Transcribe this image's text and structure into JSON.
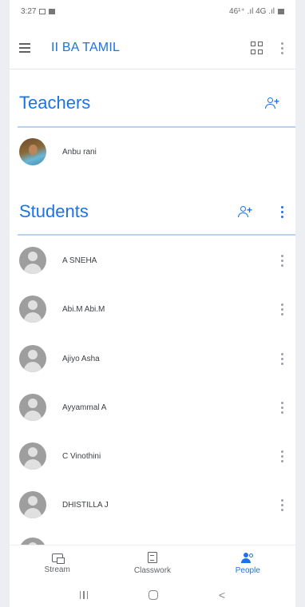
{
  "status_bar": {
    "time": "3:27",
    "right_text": "46¹⁺ .ıl 4G .ıl"
  },
  "app_bar": {
    "title": "II BA TAMIL",
    "icons": [
      "menu-icon",
      "grid-icon",
      "more-vert-icon"
    ]
  },
  "teachers": {
    "heading": "Teachers",
    "items": [
      {
        "name": "Anbu rani",
        "avatar": "photo"
      }
    ]
  },
  "students": {
    "heading": "Students",
    "items": [
      {
        "name": "A SNEHA"
      },
      {
        "name": "Abi.M Abi.M"
      },
      {
        "name": "Ajiyo Asha"
      },
      {
        "name": "Ayyammal A"
      },
      {
        "name": "C Vinothini"
      },
      {
        "name": "DHISTILLA J"
      }
    ]
  },
  "bottom_nav": {
    "items": [
      {
        "label": "Stream",
        "icon": "stream-icon",
        "active": false
      },
      {
        "label": "Classwork",
        "icon": "classwork-icon",
        "active": false
      },
      {
        "label": "People",
        "icon": "people-icon",
        "active": true
      }
    ]
  },
  "system_nav": {
    "back_glyph": "<"
  },
  "colors": {
    "accent": "#1a73e8",
    "divider": "#b9d1f3",
    "avatar_placeholder": "#9e9e9e"
  }
}
